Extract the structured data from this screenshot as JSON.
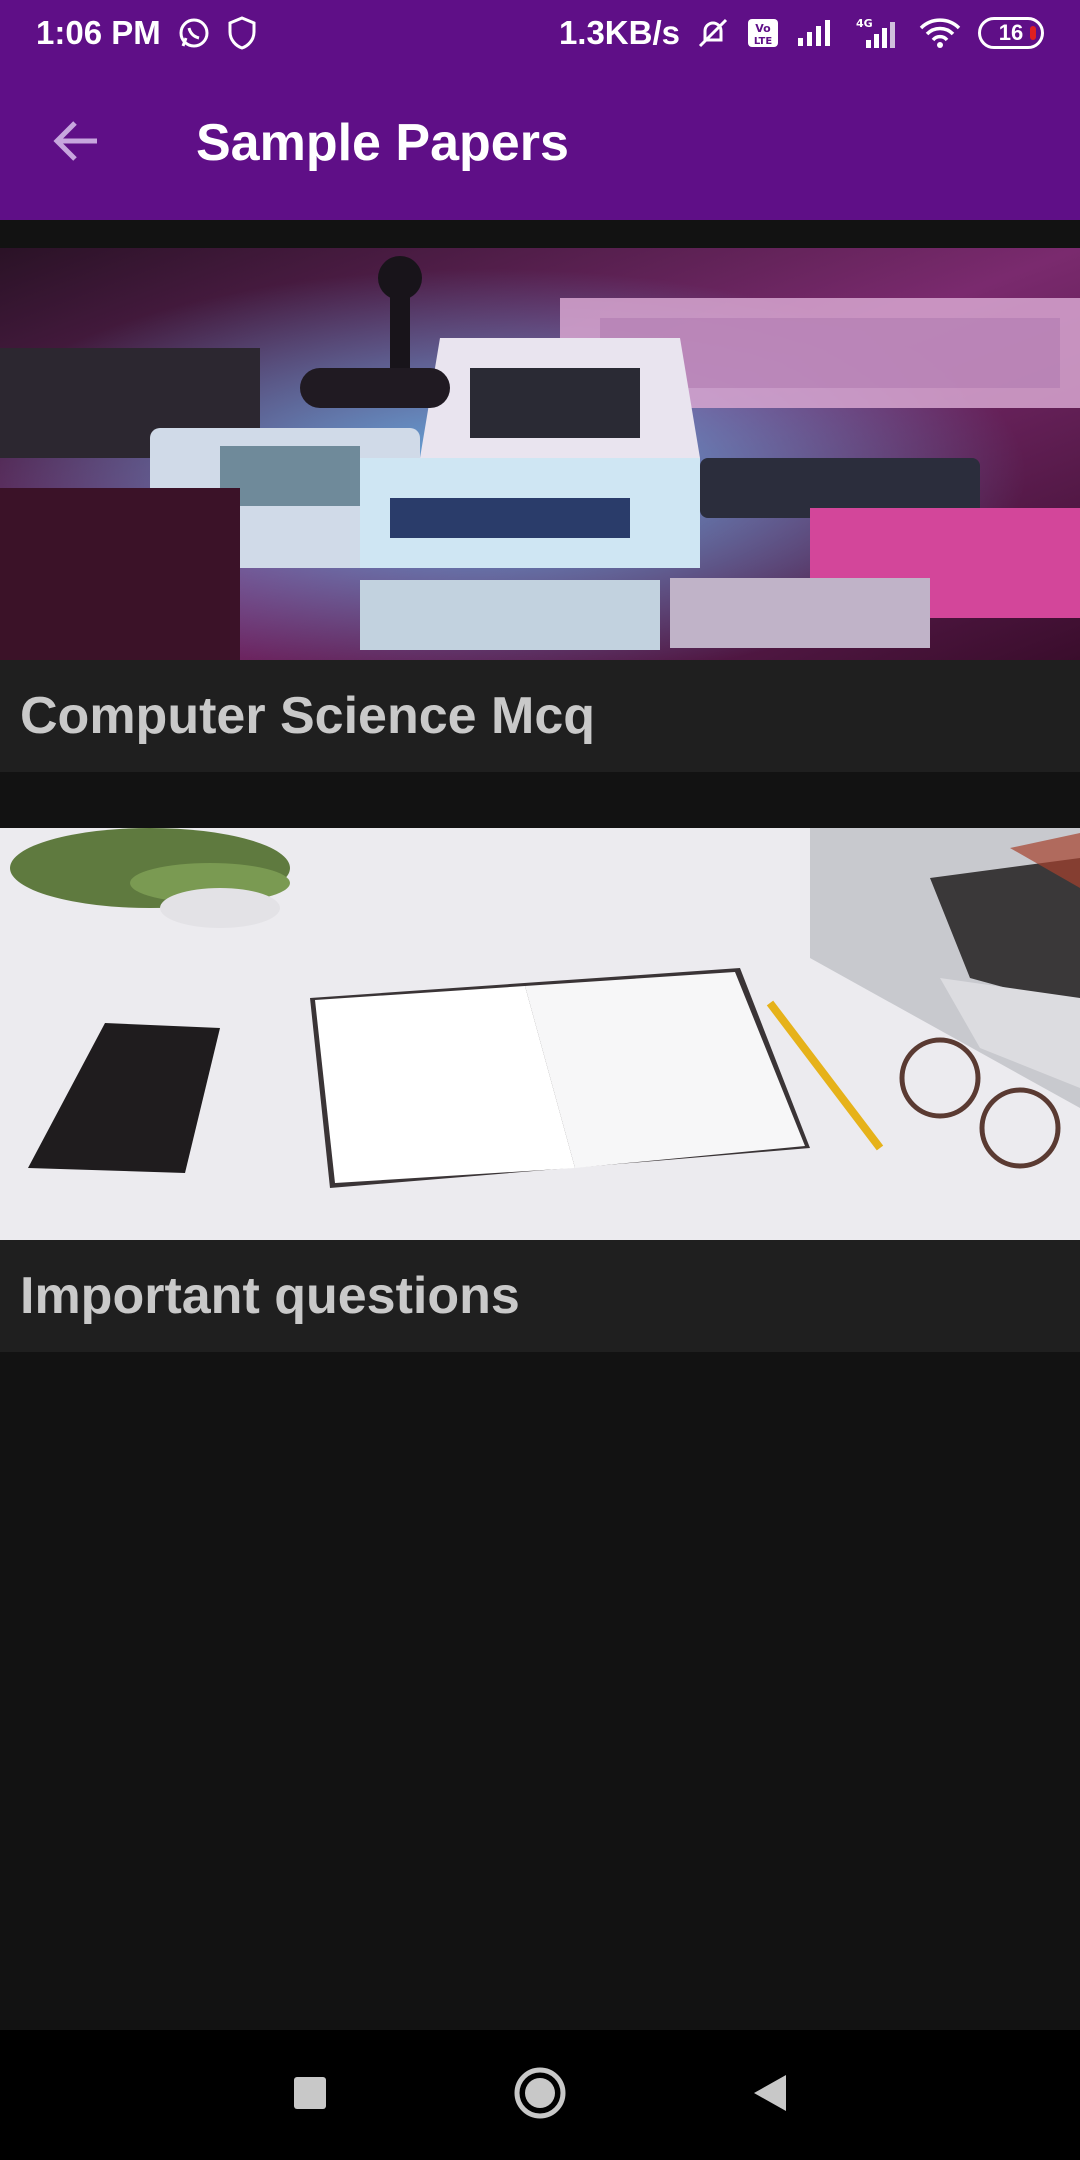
{
  "status_bar": {
    "time": "1:06 PM",
    "network_speed": "1.3KB/s",
    "battery_level": "16",
    "icons": [
      "whatsapp-icon",
      "shield-icon",
      "mute-icon",
      "volte-icon",
      "signal-icon",
      "4g-signal-icon",
      "wifi-icon",
      "battery-icon"
    ]
  },
  "app_bar": {
    "back_icon": "arrow-left-icon",
    "title": "Sample Papers"
  },
  "cards": [
    {
      "label": "Computer Science Mcq",
      "image": "retro-computers-photo"
    },
    {
      "label": "Important questions",
      "image": "desk-notebook-photo"
    }
  ],
  "nav_bar": {
    "icons": [
      "recents-square-icon",
      "home-circle-icon",
      "back-triangle-icon"
    ]
  },
  "colors": {
    "primary": "#5f0f87",
    "background": "#121212",
    "card": "#1f1f1f",
    "card_text": "#c9c9c9"
  }
}
